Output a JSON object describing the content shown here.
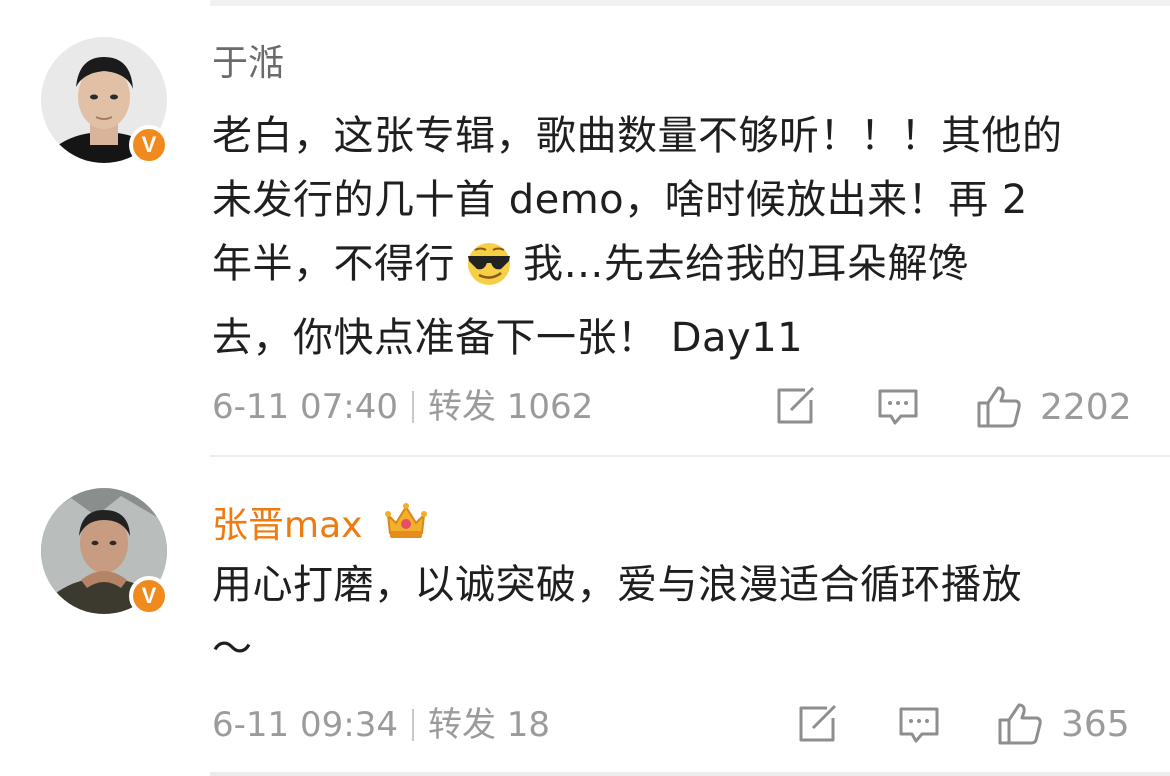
{
  "comments": [
    {
      "username": "于湉",
      "verified_badge": "V",
      "lines": [
        "老白，这张专辑，歌曲数量不够听！！！其他的",
        "未发行的几十首 demo，啥时候放出来！再 2",
        "年半，不得行",
        "我…先去给我的耳朵解馋",
        "去，你快点准备下一张！ Day11"
      ],
      "emoji": "sunglasses-smirk-emoji",
      "time": "6-11 07:40",
      "repost_label": "转发",
      "repost_count": "1062",
      "likes": "2202"
    },
    {
      "username": "张晋max",
      "verified_badge": "V",
      "crown": "crown-icon",
      "lines": [
        "用心打磨，以诚突破，爱与浪漫适合循环播放",
        "～"
      ],
      "time": "6-11 09:34",
      "repost_label": "转发",
      "repost_count": "18",
      "likes": "365"
    }
  ],
  "colors": {
    "username_normal": "#6b6b6b",
    "username_vip": "#ef7b10",
    "badge_orange": "#f08a1d",
    "meta_gray": "#9b9b9b"
  }
}
